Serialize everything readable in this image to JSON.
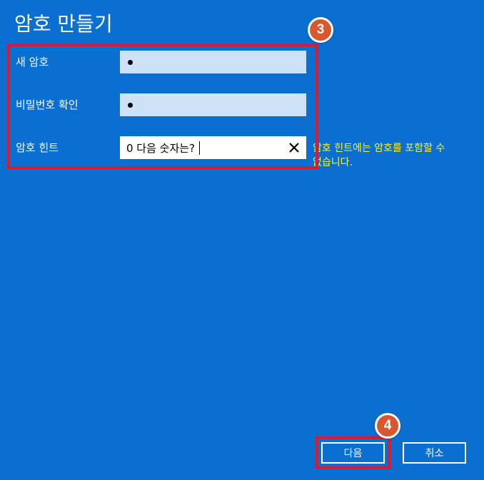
{
  "page": {
    "title": "암호 만들기"
  },
  "form": {
    "new_password": {
      "label": "새 암호"
    },
    "confirm_password": {
      "label": "비밀번호 확인"
    },
    "hint": {
      "label": "암호 힌트",
      "value": "0 다음 숫자는?",
      "clear_icon": "close-icon"
    },
    "warning_text": "암호 힌트에는 암호를 포함할 수 없습니다."
  },
  "annotations": {
    "step_form": "3",
    "step_next": "4"
  },
  "buttons": {
    "next_label": "다음",
    "cancel_label": "취소"
  },
  "colors": {
    "background": "#0b6fd2",
    "input_fill": "#cde2f6",
    "warning": "#f5f542",
    "annotation_red": "#e0182d",
    "badge_orange": "#d9572f"
  }
}
